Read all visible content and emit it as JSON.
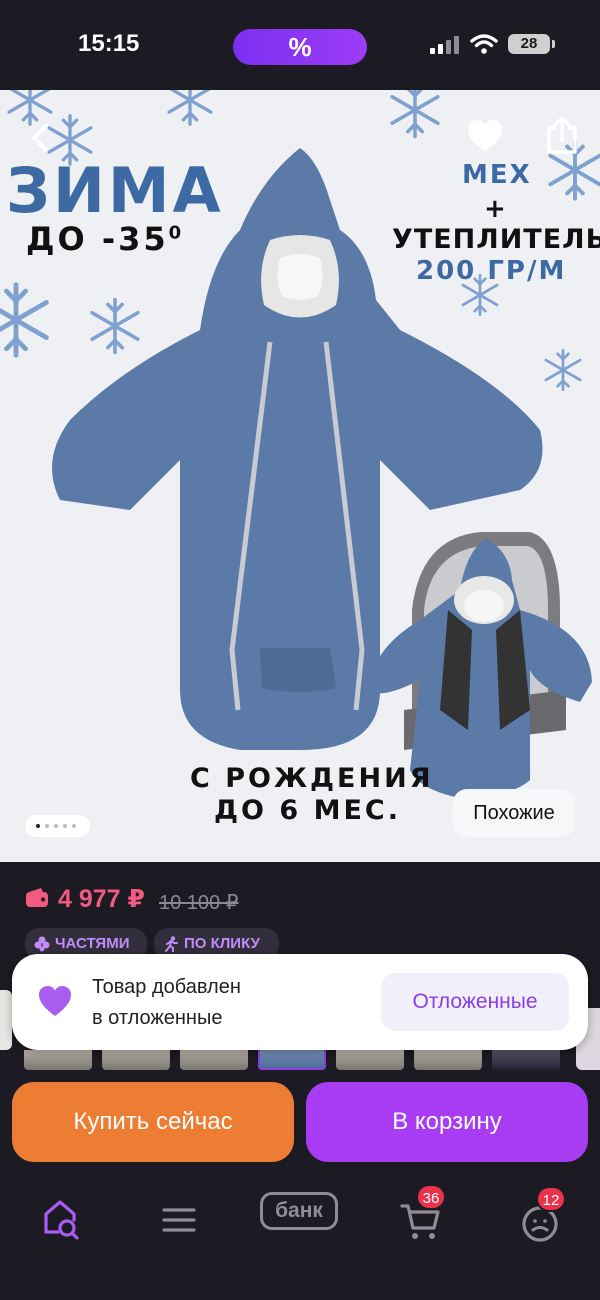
{
  "status_bar": {
    "time": "15:15",
    "promo_symbol": "%",
    "battery_level": "28"
  },
  "hero": {
    "headline": "ЗИМА",
    "temperature": "ДО -35",
    "temperature_degree": "0",
    "feature_fur": "МЕХ",
    "feature_plus": "+",
    "feature_insulation": "УТЕПЛИТЕЛЬ",
    "feature_density": "200 ГР/М",
    "age_line1": "С РОЖДЕНИЯ",
    "age_line2": "ДО 6 МЕС.",
    "similar_button": "Похожие",
    "carousel_total": 5,
    "carousel_active": 1,
    "product_color": "#5b7aa8"
  },
  "price": {
    "current": "4 977 ₽",
    "old": "10 100 ₽",
    "badge_parts": "ЧАСТЯМИ",
    "badge_click": "ПО КЛИКУ"
  },
  "toast": {
    "message_line1": "Товар добавлен",
    "message_line2": "в отложенные",
    "action_label": "Отложенные"
  },
  "actions": {
    "buy_now": "Купить сейчас",
    "add_to_cart": "В корзину"
  },
  "bottom_nav": {
    "bank_label": "банк",
    "cart_count": "36",
    "profile_count": "12"
  },
  "colors": {
    "accent_purple": "#a83cf2",
    "buy_orange": "#ee7d34",
    "price_pink": "#f25a80",
    "badge_red": "#e8334a"
  }
}
